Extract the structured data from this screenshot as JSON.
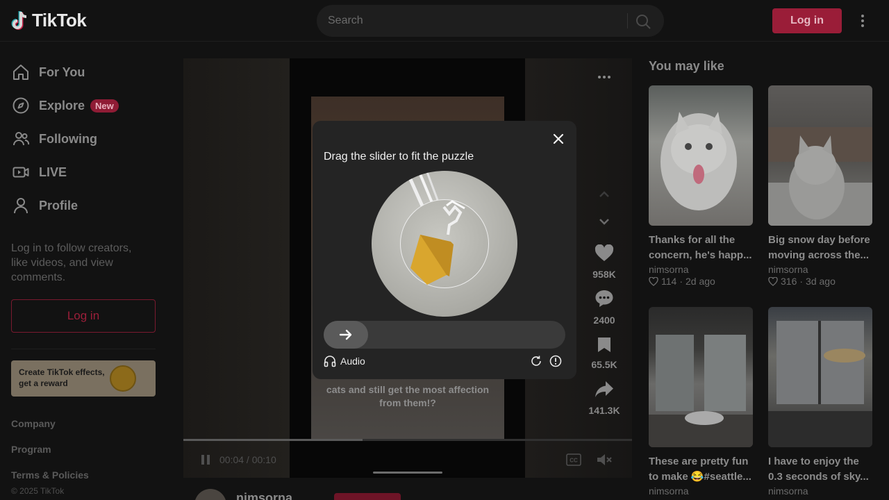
{
  "header": {
    "logo_text": "TikTok",
    "search_placeholder": "Search",
    "login_label": "Log in"
  },
  "sidebar": {
    "items": [
      {
        "label": "For You",
        "icon": "home-icon"
      },
      {
        "label": "Explore",
        "icon": "compass-icon",
        "badge": "New"
      },
      {
        "label": "Following",
        "icon": "people-icon"
      },
      {
        "label": "LIVE",
        "icon": "live-icon"
      },
      {
        "label": "Profile",
        "icon": "user-icon"
      }
    ],
    "login_prompt": "Log in to follow creators, like videos, and view comments.",
    "login_button": "Log in",
    "promo_text": "Create TikTok effects, get a reward",
    "footer_links": [
      "Company",
      "Program",
      "Terms & Policies"
    ],
    "copyright": "© 2025 TikTok"
  },
  "video": {
    "caption": "cats and still get the most affection from them!?",
    "time": "00:04 / 00:10",
    "progress": 0.4,
    "likes": "958K",
    "comments": "2400",
    "saves": "65.5K",
    "shares": "141.3K",
    "author": "nimsorna"
  },
  "recommendations": {
    "title": "You may like",
    "cards": [
      {
        "title": "Thanks for all the concern, he's happ...",
        "author": "nimsorna",
        "likes": "114",
        "age": "2d ago"
      },
      {
        "title": "Big snow day before moving across the...",
        "author": "nimsorna",
        "likes": "316",
        "age": "3d ago"
      },
      {
        "title": "These are pretty fun to make 😂#seattle...",
        "author": "nimsorna"
      },
      {
        "title": "I have to enjoy the 0.3 seconds of sky...",
        "author": "nimsorna"
      }
    ]
  },
  "captcha": {
    "title": "Drag the slider to fit the puzzle",
    "audio_label": "Audio"
  },
  "colors": {
    "accent": "#fe2c55",
    "background": "#121212"
  }
}
